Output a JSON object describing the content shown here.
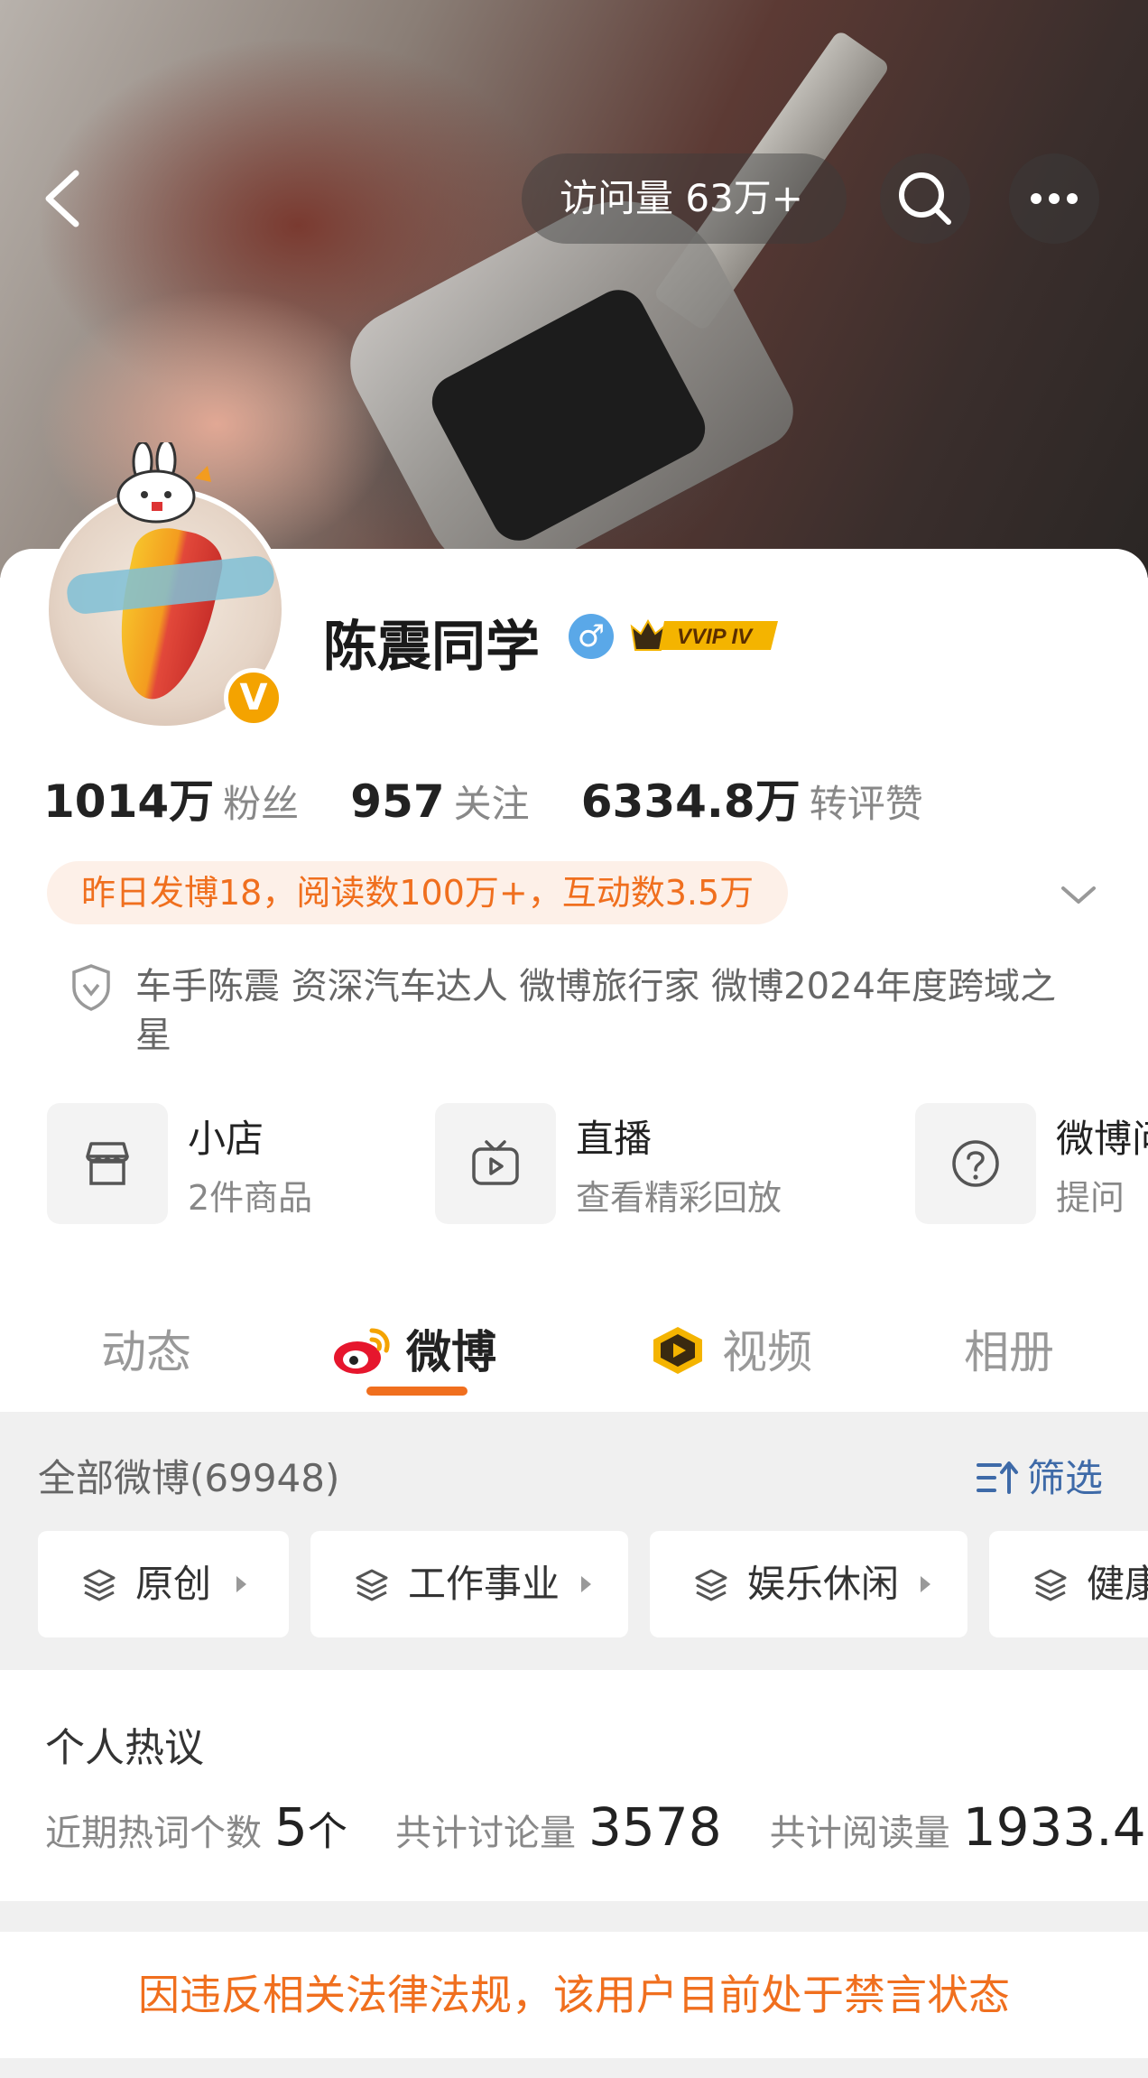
{
  "header": {
    "visits": "访问量 63万+"
  },
  "profile": {
    "name": "陈震同学",
    "gender_symbol": "♂",
    "vip_label": "VVIP IV",
    "verified_symbol": "V",
    "stats": [
      {
        "value": "1014万",
        "label": "粉丝"
      },
      {
        "value": "957",
        "label": "关注"
      },
      {
        "value": "6334.8万",
        "label": "转评赞"
      }
    ],
    "activity": "昨日发博18，阅读数100万+，互动数3.5万",
    "bio": "车手陈震 资深汽车达人 微博旅行家 微博2024年度跨域之星"
  },
  "services": [
    {
      "icon": "store-icon",
      "title": "小店",
      "subtitle": "2件商品"
    },
    {
      "icon": "live-tv-icon",
      "title": "直播",
      "subtitle": "查看精彩回放"
    },
    {
      "icon": "question-icon",
      "title": "微博问",
      "subtitle": "提问"
    }
  ],
  "tabs": [
    {
      "label": "动态",
      "active": false
    },
    {
      "label": "微博",
      "active": true,
      "icon": "weibo-logo-icon"
    },
    {
      "label": "视频",
      "active": false,
      "icon": "video-badge-icon"
    },
    {
      "label": "相册",
      "active": false
    }
  ],
  "feed": {
    "all_count": "全部微博(69948)",
    "filter_label": "筛选",
    "chips": [
      "原创",
      "工作事业",
      "娱乐休闲",
      "健康"
    ]
  },
  "hot": {
    "title": "个人热议",
    "stats": [
      {
        "label": "近期热词个数",
        "value": "5",
        "unit": "个"
      },
      {
        "label": "共计讨论量",
        "value": "3578",
        "unit": ""
      },
      {
        "label": "共计阅读量",
        "value": "1933.4",
        "unit": ""
      }
    ]
  },
  "notice": "因违反相关法律法规，该用户目前处于禁言状态",
  "colors": {
    "accent": "#f06f1e",
    "link": "#3e6aa8",
    "vip_gold": "#f4a300"
  }
}
